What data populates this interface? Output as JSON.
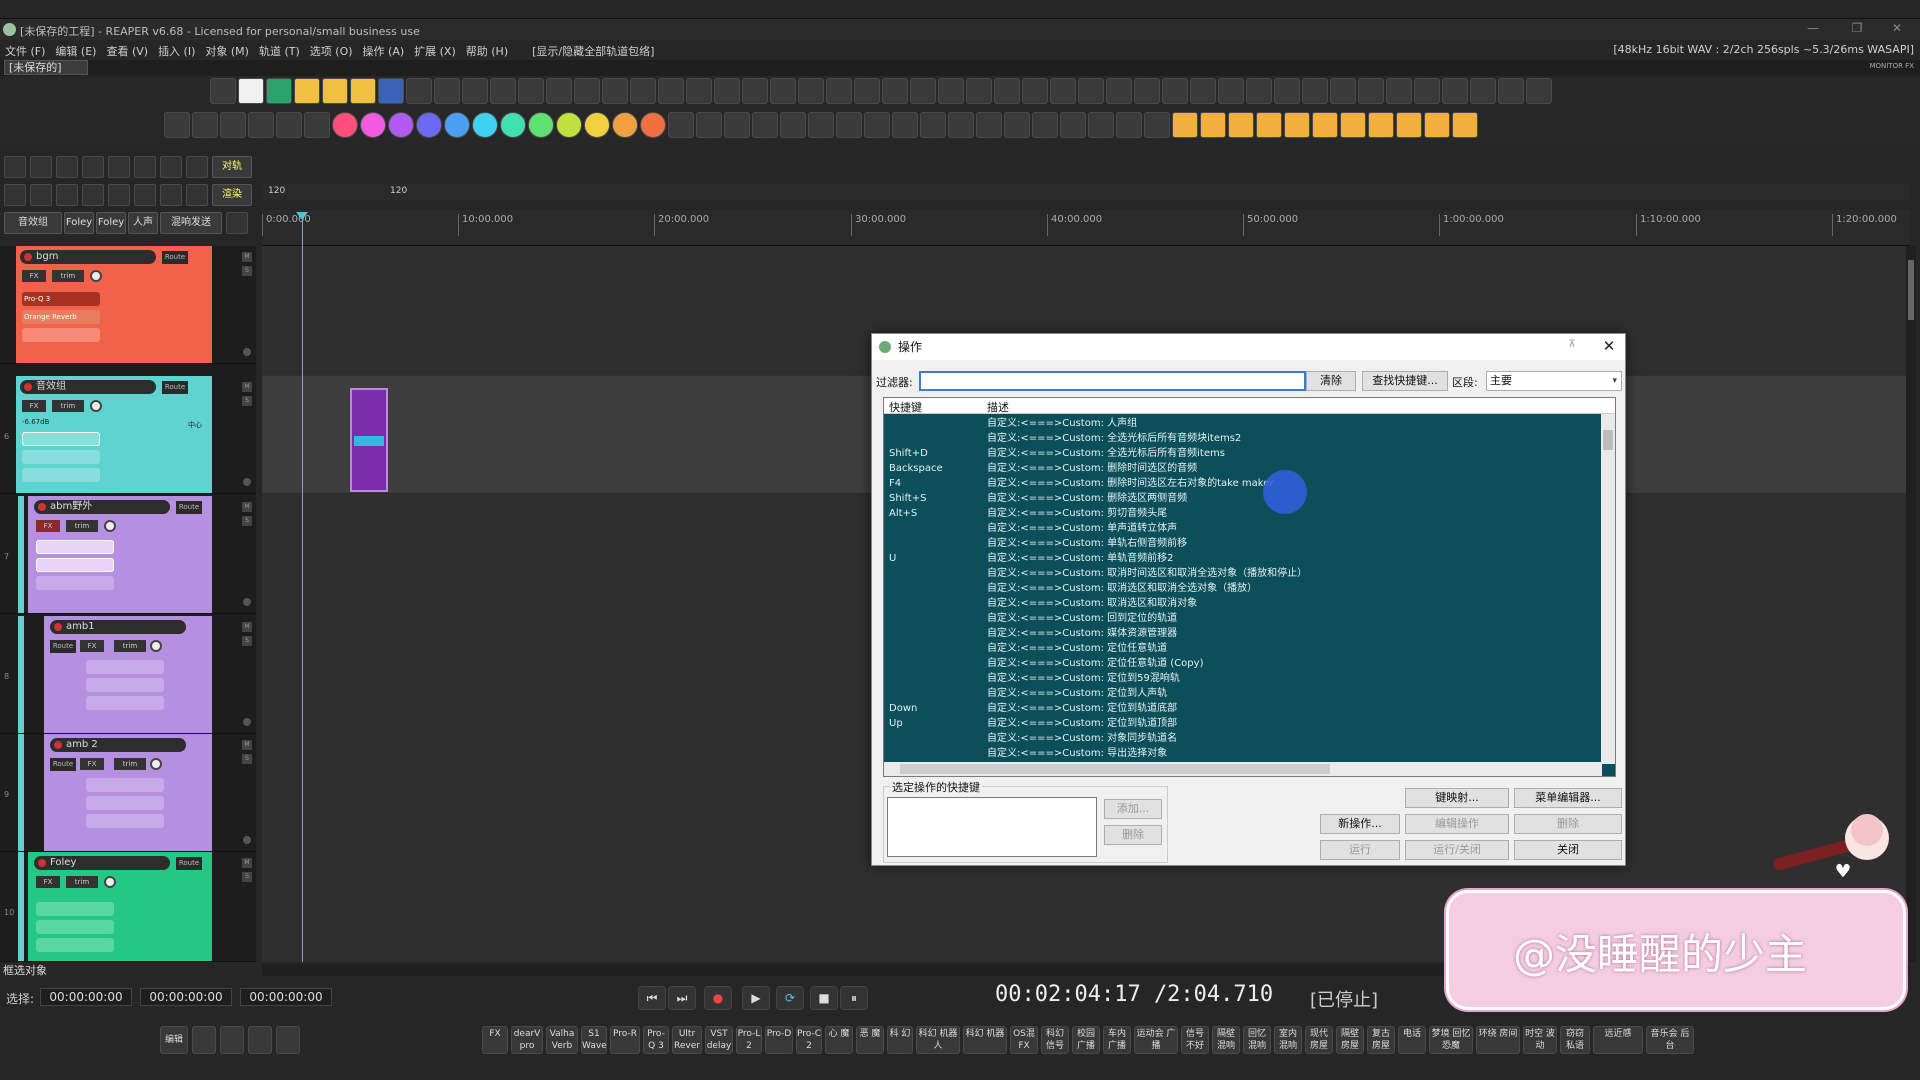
{
  "window": {
    "title": "[未保存的工程] - REAPER v6.68 - Licensed for personal/small business use",
    "minimize": "—",
    "restore": "❐",
    "close": "✕"
  },
  "menu": {
    "items": [
      "文件 (F)",
      "编辑 (E)",
      "查看 (V)",
      "插入 (I)",
      "对象 (M)",
      "轨道 (T)",
      "选项 (O)",
      "操作 (A)",
      "扩展 (X)",
      "帮助 (H)",
      "[显示/隐藏全部轨道包络]"
    ],
    "status": "[48kHz 16bit WAV : 2/2ch 256spls ~5.3/26ms WASAPI]"
  },
  "project_tab": "[未保存的]",
  "monitor_fx": "MONITOR FX",
  "left_buttons": [
    "音效组",
    "Foley",
    "Foley",
    "人声",
    "混响发送"
  ],
  "left_labels": {
    "align": "对轨",
    "render": "渲染"
  },
  "ruler": {
    "tempo1": "120",
    "tempo2": "120",
    "ticks": [
      "0:00.000",
      "10:00.000",
      "20:00.000",
      "30:00.000",
      "40:00.000",
      "50:00.000",
      "1:00:00.000",
      "1:10:00.000",
      "1:20:00.000"
    ]
  },
  "tracks": [
    {
      "num": "",
      "name": "bgm",
      "color": "#f0634a",
      "fx": "FX",
      "trim": "trim",
      "route": "Route",
      "plugins": [
        "Pro-Q 3",
        "Orange Reverb"
      ]
    },
    {
      "num": "6",
      "name": "音效组",
      "color": "#5fd3cf",
      "fx": "FX",
      "trim": "trim",
      "route": "Route",
      "db": "-6.67dB",
      "pan": "中心"
    },
    {
      "num": "7",
      "name": "abm野外",
      "color": "#b58fe0",
      "fx": "FX",
      "trim": "trim",
      "route": "Route"
    },
    {
      "num": "8",
      "name": "amb1",
      "color": "#b58fe0",
      "fx": "FX",
      "trim": "trim",
      "route": "Route"
    },
    {
      "num": "9",
      "name": "amb 2",
      "color": "#b58fe0",
      "fx": "FX",
      "trim": "trim",
      "route": "Route"
    },
    {
      "num": "10",
      "name": "Foley",
      "color": "#22c883",
      "fx": "FX",
      "trim": "trim",
      "route": "Route"
    }
  ],
  "status_bar": "框选对象",
  "transport": {
    "select_label": "选择:",
    "start": "00:00:00:00",
    "end": "00:00:00:00",
    "length": "00:00:00:00",
    "time": "00:02:04:17 /2:04.710",
    "state": "[已停止]",
    "buttons": [
      "⏮",
      "⏭",
      "●",
      "▶",
      "⟳",
      "■",
      "⏸"
    ]
  },
  "bottom_left": [
    "编辑"
  ],
  "bottom_buttons": [
    "FX",
    "dearV pro",
    "Valha Verb",
    "S1 Wave",
    "Pro-R",
    "Pro-Q 3",
    "Ultr Rever",
    "VST delay",
    "Pro-L 2",
    "Pro-D",
    "Pro-C 2",
    "心 魔",
    "恶 魔",
    "科 幻",
    "科幻 机器人",
    "科幻 机器",
    "OS混 FX",
    "科幻 信号",
    "校园 广播",
    "车内 广播",
    "运动会 广播",
    "信号 不好",
    "隔壁 混响",
    "回忆 混响",
    "室内 混响",
    "现代 房屋",
    "隔壁 房屋",
    "复古 房屋",
    "电话",
    "梦境 回忆恐魔",
    "环绕 房间",
    "时空 波动",
    "窃窃 私语",
    "远近感",
    "音乐会 后台"
  ],
  "dialog": {
    "title": "操作",
    "filter_label": "过滤器:",
    "filter_value": "",
    "clear": "清除",
    "find_shortcut": "查找快捷键...",
    "section_label": "区段:",
    "section_value": "主要",
    "columns": [
      "快捷键",
      "描述"
    ],
    "rows": [
      {
        "key": "",
        "desc": "自定义:<===>Custom: 人声组"
      },
      {
        "key": "",
        "desc": "自定义:<===>Custom: 全选光标后所有音频块items2"
      },
      {
        "key": "Shift+D",
        "desc": "自定义:<===>Custom: 全选光标后所有音频items"
      },
      {
        "key": "Backspace",
        "desc": "自定义:<===>Custom: 删除时间选区的音频"
      },
      {
        "key": "F4",
        "desc": "自定义:<===>Custom: 删除时间选区左右对象的take maker"
      },
      {
        "key": "Shift+S",
        "desc": "自定义:<===>Custom: 删除选区两侧音频"
      },
      {
        "key": "Alt+S",
        "desc": "自定义:<===>Custom: 剪切音频头尾"
      },
      {
        "key": "",
        "desc": "自定义:<===>Custom: 单声道转立体声"
      },
      {
        "key": "",
        "desc": "自定义:<===>Custom: 单轨右侧音频前移"
      },
      {
        "key": "U",
        "desc": "自定义:<===>Custom: 单轨音频前移2"
      },
      {
        "key": "",
        "desc": "自定义:<===>Custom: 取消时间选区和取消全选对象（播放和停止）"
      },
      {
        "key": "",
        "desc": "自定义:<===>Custom: 取消选区和取消全选对象（播放）"
      },
      {
        "key": "",
        "desc": "自定义:<===>Custom: 取消选区和取消对象"
      },
      {
        "key": "",
        "desc": "自定义:<===>Custom: 回到定位的轨道"
      },
      {
        "key": "",
        "desc": "自定义:<===>Custom: 媒体资源管理器"
      },
      {
        "key": "",
        "desc": "自定义:<===>Custom: 定位任意轨道"
      },
      {
        "key": "",
        "desc": "自定义:<===>Custom: 定位任意轨道 (Copy)"
      },
      {
        "key": "",
        "desc": "自定义:<===>Custom: 定位到59混响轨"
      },
      {
        "key": "",
        "desc": "自定义:<===>Custom: 定位到人声轨"
      },
      {
        "key": "Down",
        "desc": "自定义:<===>Custom: 定位到轨道底部"
      },
      {
        "key": "Up",
        "desc": "自定义:<===>Custom: 定位到轨道顶部"
      },
      {
        "key": "",
        "desc": "自定义:<===>Custom: 对象同步轨道名"
      },
      {
        "key": "",
        "desc": "自定义:<===>Custom: 导出选择对象"
      }
    ],
    "group_label": "选定操作的快捷键",
    "add": "添加...",
    "delete_shortcut": "删除",
    "key_map": "键映射...",
    "menu_editor": "菜单编辑器...",
    "new_action": "新操作...",
    "edit_action": "编辑操作",
    "delete_action": "删除",
    "run": "运行",
    "run_close": "运行/关闭",
    "close": "关闭"
  },
  "watermark": "@没睡醒的少主"
}
